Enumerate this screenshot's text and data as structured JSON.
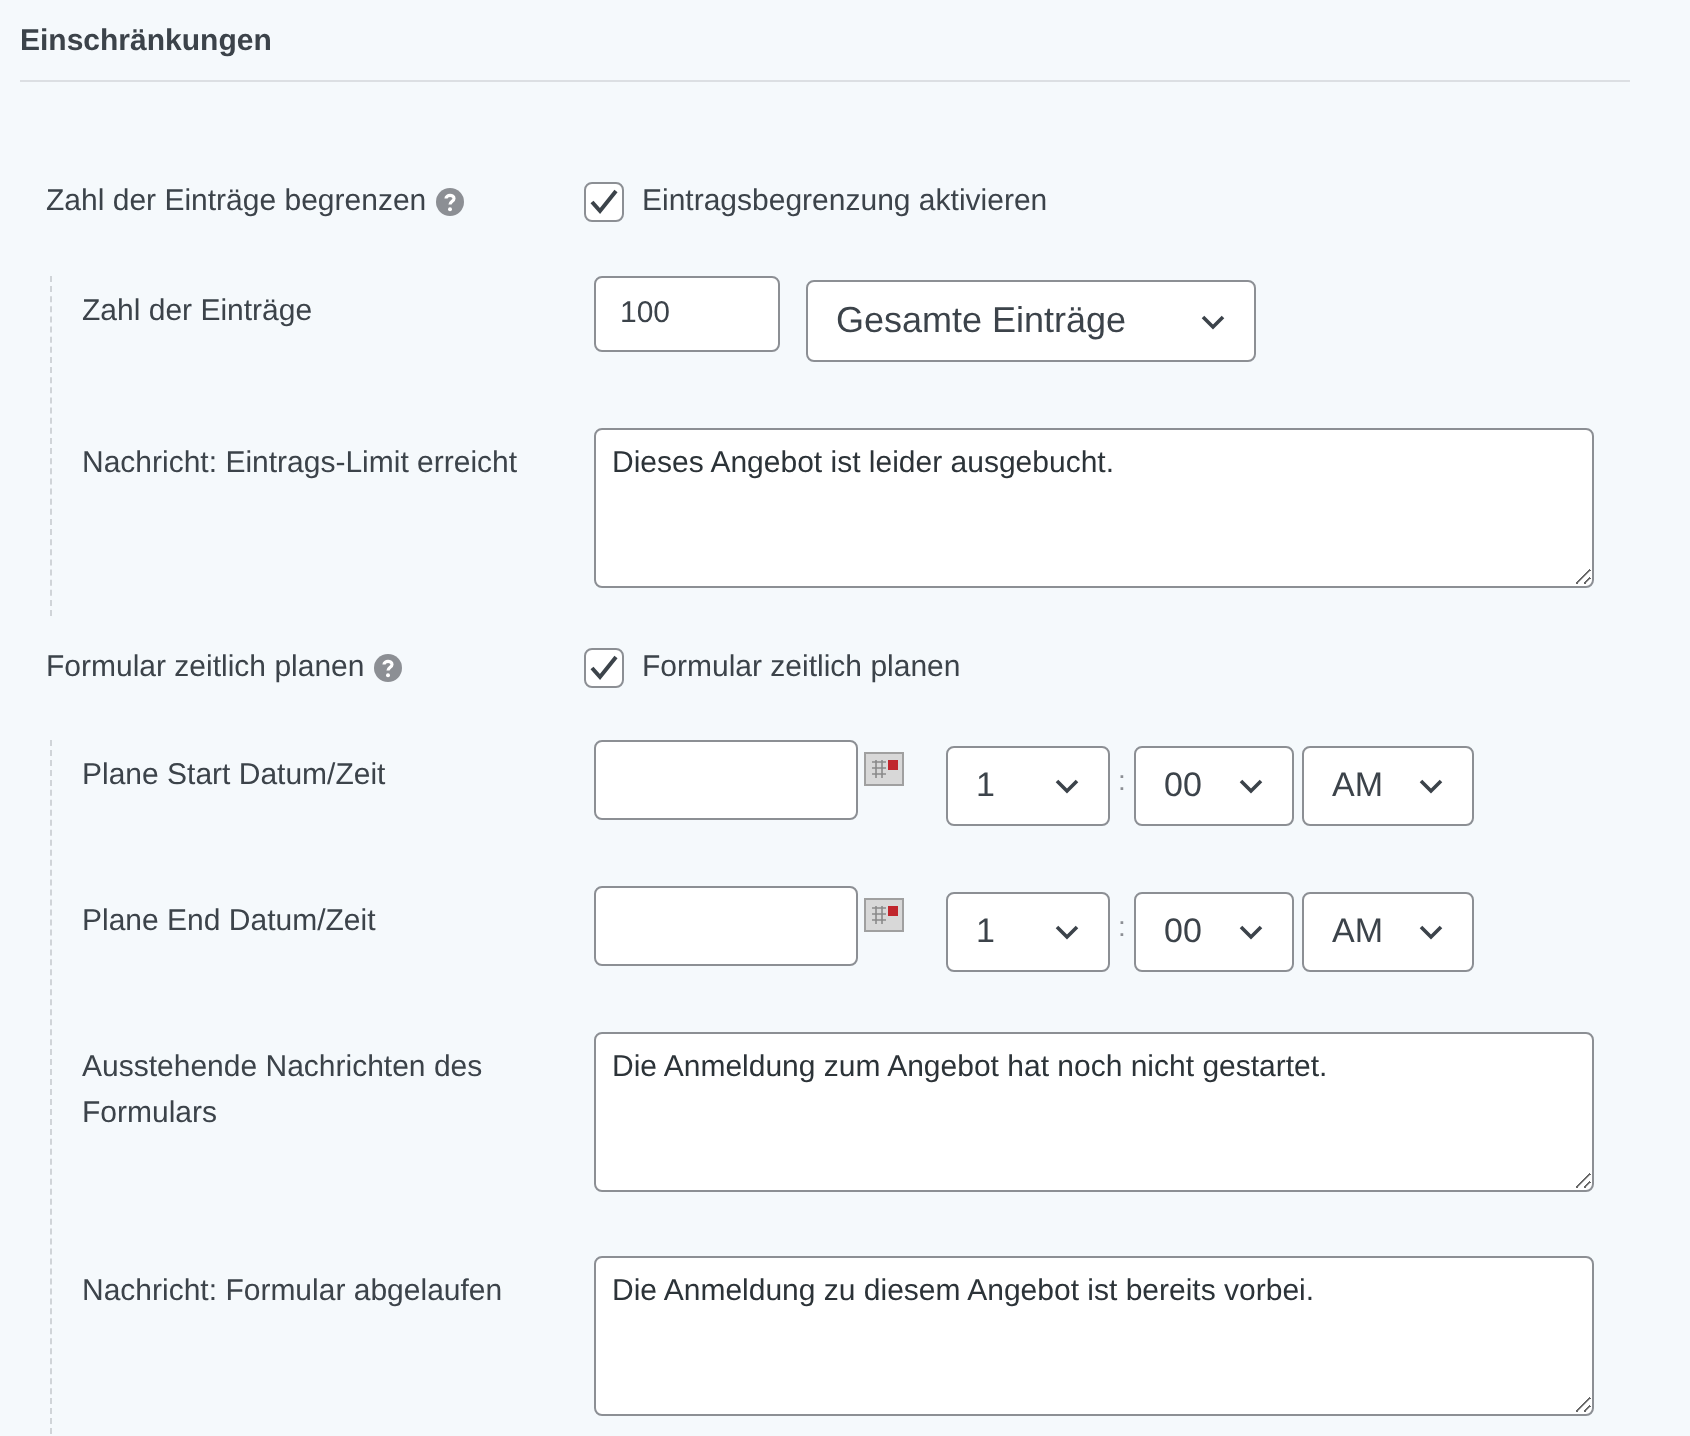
{
  "section_title": "Einschränkungen",
  "groups": [
    {
      "label": "Zahl der Einträge begrenzen",
      "checkbox": {
        "label": "Eintragsbegrenzung aktivieren",
        "checked": true
      },
      "rows": [
        {
          "kind": "number_select",
          "label": "Zahl der Einträge",
          "value": "100",
          "select": "Gesamte Einträge"
        },
        {
          "kind": "textarea",
          "label": "Nachricht: Eintrags-Limit erreicht",
          "value": "Dieses Angebot ist leider ausgebucht."
        }
      ]
    },
    {
      "label": "Formular zeitlich planen",
      "checkbox": {
        "label": "Formular zeitlich planen",
        "checked": true
      },
      "rows": [
        {
          "kind": "datetime",
          "label": "Plane Start Datum/Zeit",
          "hour": "1",
          "separator": ":",
          "minute": "00",
          "ampm": "AM"
        },
        {
          "kind": "datetime",
          "label": "Plane End Datum/Zeit",
          "hour": "1",
          "separator": ":",
          "minute": "00",
          "ampm": "AM"
        },
        {
          "kind": "textarea",
          "label": "Ausstehende Nachrichten des Formulars",
          "value": "Die Anmeldung zum Angebot hat noch nicht gestartet."
        },
        {
          "kind": "textarea",
          "label": "Nachricht: Formular abgelaufen",
          "value": "Die Anmeldung zu diesem Angebot ist bereits vorbei."
        }
      ]
    }
  ]
}
